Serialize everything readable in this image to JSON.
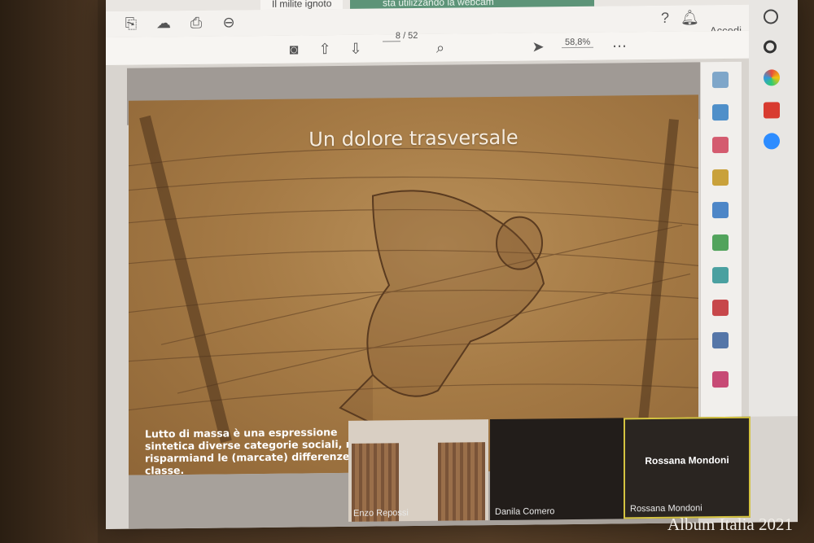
{
  "browser": {
    "tab_title": "Il milite ignoto",
    "notification": "sta utilizzando la webcam",
    "signin": "Accedi"
  },
  "pdf": {
    "page_current": "8",
    "page_total": "/ 52",
    "zoom": "58,8%"
  },
  "slide": {
    "title": "Un dolore trasversale",
    "text": "Lutto di massa è una espressione sintetica diverse categorie sociali, non risparmiand le (marcate) differenze di classe."
  },
  "meeting": {
    "participants": [
      {
        "name": "Enzo Repossi"
      },
      {
        "name": "Danila Comero"
      },
      {
        "name": "Rossana Mondoni",
        "display": "Rossana Mondoni"
      }
    ]
  },
  "watermark": "Album Italia 2021",
  "colors": {
    "notification": "#5d9478",
    "active_speaker_border": "#d4c341",
    "slide_bg": "#a57a45"
  },
  "icons": [
    "save-icon",
    "upload-icon",
    "print-icon",
    "zoom-out-icon",
    "camera-icon",
    "arrow-up-icon",
    "arrow-down-icon",
    "search-icon",
    "select-icon",
    "more-icon",
    "help-icon",
    "bell-icon"
  ]
}
